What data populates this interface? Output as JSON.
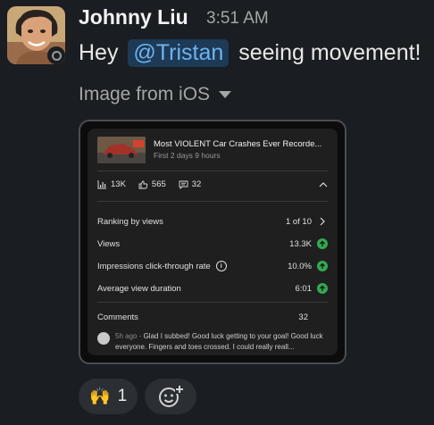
{
  "message": {
    "author": "Johnny Liu",
    "time": "3:51 AM",
    "text_before": "Hey",
    "mention": "@Tristan",
    "text_after": "seeing movement!"
  },
  "attachment": {
    "label": "Image from iOS",
    "video": {
      "title": "Most VIOLENT Car Crashes Ever Recorde...",
      "subtitle": "First 2 days 9 hours",
      "views_stat": "13K",
      "likes_stat": "565",
      "comments_stat": "32"
    },
    "metrics": [
      {
        "label": "Ranking by views",
        "value": "1 of 10"
      },
      {
        "label": "Views",
        "value": "13.3K"
      },
      {
        "label": "Impressions click-through rate",
        "value": "10.0%"
      },
      {
        "label": "Average view duration",
        "value": "6:01"
      }
    ],
    "comments": {
      "label": "Comments",
      "count": "32",
      "ago": "5h ago",
      "text": "Glad I subbed! Good luck getting to your goal! Good luck everyone. Fingers and toes crossed. I could really reall..."
    }
  },
  "reactions": [
    {
      "emoji": "🙌",
      "count": "1"
    }
  ],
  "colors": {
    "background": "#1a1d21",
    "mention_bg": "#1d3a56",
    "mention_text": "#6fb3ee",
    "up_green": "#33a852"
  }
}
